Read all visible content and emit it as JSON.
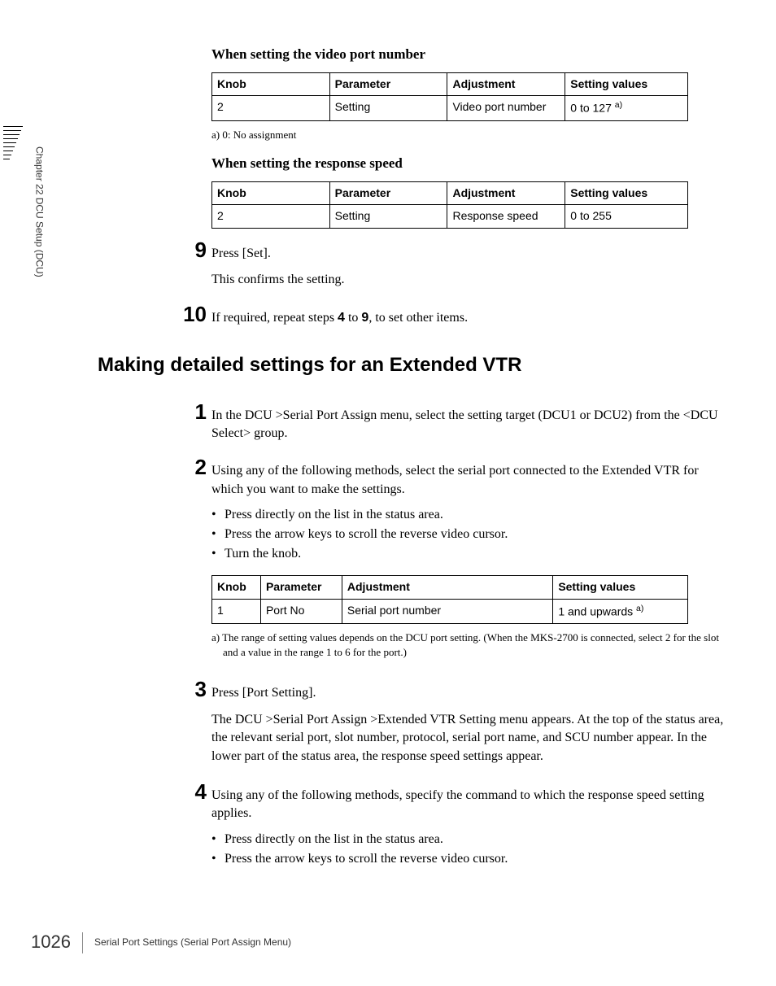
{
  "side_label": "Chapter 22  DCU Setup (DCU)",
  "sec1": {
    "heading": "When setting the video port number",
    "table": {
      "head": [
        "Knob",
        "Parameter",
        "Adjustment",
        "Setting values"
      ],
      "row": [
        "2",
        "Setting",
        "Video port number",
        "0 to 127 ",
        "a)"
      ]
    },
    "footnote": "a) 0: No assignment"
  },
  "sec2": {
    "heading": "When setting the response speed",
    "table": {
      "head": [
        "Knob",
        "Parameter",
        "Adjustment",
        "Setting values"
      ],
      "row": [
        "2",
        "Setting",
        "Response speed",
        "0 to 255"
      ]
    }
  },
  "step9": {
    "num": "9",
    "text": "Press [Set].",
    "cont": "This confirms the setting."
  },
  "step10": {
    "num": "10",
    "prefix": "If required, repeat steps ",
    "b1": "4",
    "mid": " to ",
    "b2": "9",
    "suffix": ", to set other items."
  },
  "h2": "Making detailed settings for an Extended VTR",
  "s1": {
    "num": "1",
    "text": "In the DCU >Serial Port Assign menu, select the setting target (DCU1 or DCU2) from the <DCU Select> group."
  },
  "s2": {
    "num": "2",
    "text": "Using any of the following methods, select the serial port connected to the Extended VTR for which you want to make the settings.",
    "bullets": [
      "Press directly on the list in the status area.",
      "Press the arrow keys to scroll the reverse video cursor.",
      "Turn the knob."
    ],
    "table": {
      "head": [
        "Knob",
        "Parameter",
        "Adjustment",
        "Setting values"
      ],
      "row": [
        "1",
        "Port No",
        "Serial port number",
        "1 and upwards ",
        "a)"
      ]
    },
    "footnote": "a) The range of setting values depends on the DCU port setting. (When the MKS-2700 is connected, select 2 for the slot and a value in the range 1 to 6 for the port.)"
  },
  "s3": {
    "num": "3",
    "text": "Press [Port Setting].",
    "cont": "The DCU >Serial Port Assign >Extended VTR Setting menu appears. At the top of the status area, the relevant serial port, slot number, protocol, serial port name, and SCU number appear. In the lower part of the status area, the response speed settings appear."
  },
  "s4": {
    "num": "4",
    "text": "Using any of the following methods, specify the command to which the response speed setting applies.",
    "bullets": [
      "Press directly on the list in the status area.",
      "Press the arrow keys to scroll the reverse video cursor."
    ]
  },
  "footer": {
    "page": "1026",
    "text": "Serial Port Settings (Serial Port Assign Menu)"
  }
}
